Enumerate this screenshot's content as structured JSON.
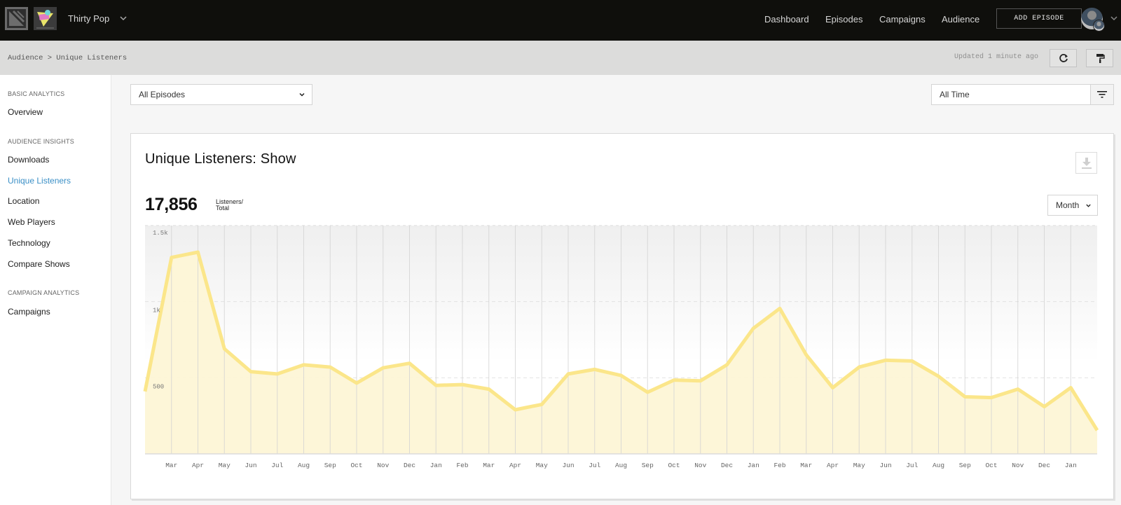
{
  "topnav": {
    "show_name": "Thirty Pop",
    "links": [
      "Dashboard",
      "Episodes",
      "Campaigns",
      "Audience"
    ],
    "add_episode_label": "ADD EPISODE"
  },
  "crumbbar": {
    "breadcrumb": "Audience > Unique Listeners",
    "updated": "Updated 1 minute ago"
  },
  "sidebar": {
    "sections": [
      {
        "title": "BASIC ANALYTICS",
        "items": [
          "Overview"
        ]
      },
      {
        "title": "AUDIENCE INSIGHTS",
        "items": [
          "Downloads",
          "Unique Listeners",
          "Location",
          "Web Players",
          "Technology",
          "Compare Shows"
        ]
      },
      {
        "title": "CAMPAIGN ANALYTICS",
        "items": [
          "Campaigns"
        ]
      }
    ],
    "active_item": "Unique Listeners"
  },
  "filters": {
    "episodes": "All Episodes",
    "time_range": "All Time"
  },
  "card": {
    "title": "Unique Listeners: Show",
    "total": "17,856",
    "total_unit_line1": "Listeners/",
    "total_unit_line2": "Total",
    "granularity": "Month"
  },
  "colors": {
    "accent_line": "#fbe68a",
    "accent_fill": "#fdf6d6",
    "active_link": "#3a8fc6",
    "nav_bg": "#0f0f0c"
  },
  "chart_data": {
    "type": "area",
    "title": "Unique Listeners: Show",
    "xlabel": "",
    "ylabel": "",
    "ylim": [
      0,
      1500
    ],
    "yticks": [
      {
        "value": 1500,
        "label": "1.5k"
      },
      {
        "value": 1000,
        "label": "1k"
      },
      {
        "value": 500,
        "label": "500"
      }
    ],
    "grid": true,
    "legend": "none",
    "x": [
      "",
      "Mar",
      "Apr",
      "May",
      "Jun",
      "Jul",
      "Aug",
      "Sep",
      "Oct",
      "Nov",
      "Dec",
      "Jan",
      "Feb",
      "Mar",
      "Apr",
      "May",
      "Jun",
      "Jul",
      "Aug",
      "Sep",
      "Oct",
      "Nov",
      "Dec",
      "Jan",
      "Feb",
      "Mar",
      "Apr",
      "May",
      "Jun",
      "Jul",
      "Aug",
      "Sep",
      "Oct",
      "Nov",
      "Dec",
      "Jan",
      ""
    ],
    "series": [
      {
        "name": "Unique Listeners",
        "values": [
          410,
          1290,
          1325,
          690,
          540,
          525,
          585,
          570,
          465,
          565,
          595,
          450,
          455,
          425,
          290,
          325,
          525,
          555,
          515,
          405,
          485,
          480,
          585,
          825,
          955,
          650,
          435,
          570,
          615,
          610,
          510,
          375,
          370,
          425,
          310,
          435,
          155
        ]
      }
    ]
  }
}
